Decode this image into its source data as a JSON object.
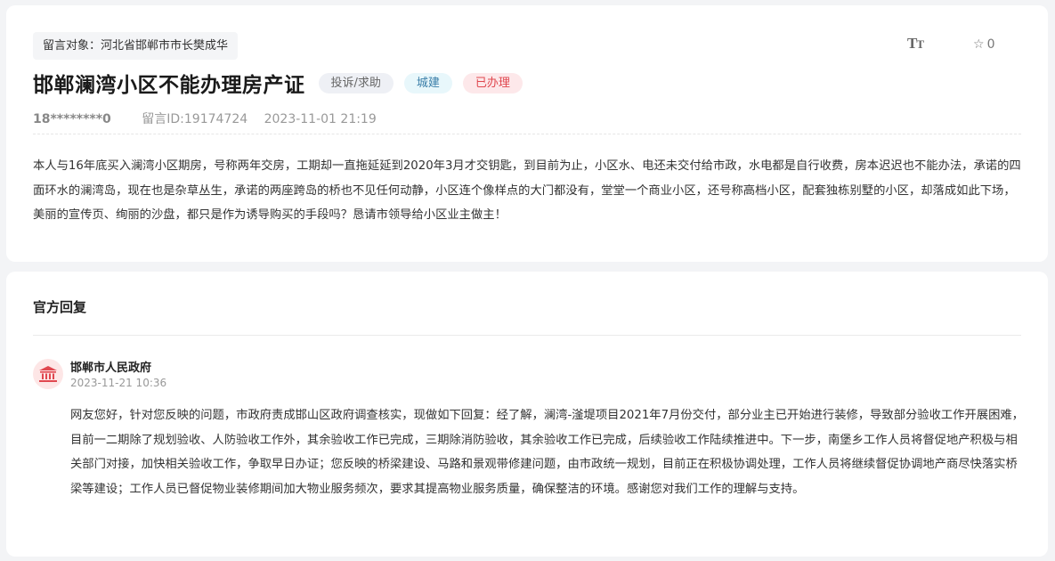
{
  "message": {
    "target_label": "留言对象：河北省邯郸市市长樊成华",
    "font_toggle_label": "TT",
    "favorites_count": "0",
    "title": "邯郸澜湾小区不能办理房产证",
    "tags": [
      "投诉/求助",
      "城建",
      "已办理"
    ],
    "user": "18********0",
    "message_id": "留言ID:19174724",
    "datetime": "2023-11-01 21:19",
    "body": "本人与16年底买入澜湾小区期房，号称两年交房，工期却一直拖延延到2020年3月才交钥匙，到目前为止，小区水、电还未交付给市政，水电都是自行收费，房本迟迟也不能办法，承诺的四面环水的澜湾岛，现在也是杂草丛生，承诺的两座跨岛的桥也不见任何动静，小区连个像样点的大门都没有，堂堂一个商业小区，还号称高档小区，配套独栋别墅的小区，却落成如此下场，美丽的宣传页、绚丽的沙盘，都只是作为诱导购买的手段吗？恳请市领导给小区业主做主！"
  },
  "reply": {
    "section_title": "官方回复",
    "org_name": "邯郸市人民政府",
    "datetime": "2023-11-21 10:36",
    "body": "网友您好，针对您反映的问题，市政府责成邯山区政府调查核实，现做如下回复：经了解，澜湾-滏堤项目2021年7月份交付，部分业主已开始进行装修，导致部分验收工作开展困难，目前一二期除了规划验收、人防验收工作外，其余验收工作已完成，三期除消防验收，其余验收工作已完成，后续验收工作陆续推进中。下一步，南堡乡工作人员将督促地产积极与相关部门对接，加快相关验收工作，争取早日办证；您反映的桥梁建设、马路和景观带修建问题，由市政统一规划，目前正在积极协调处理，工作人员将继续督促协调地产商尽快落实桥梁等建设；工作人员已督促物业装修期间加大物业服务频次，要求其提高物业服务质量，确保整洁的环境。感谢您对我们工作的理解与支持。"
  },
  "icons": {
    "font_size": "font-size-icon",
    "star": "star-icon",
    "org": "government-building-icon"
  },
  "colors": {
    "tag_status_text": "#e0474f",
    "tag_category_text": "#3a7ea8",
    "avatar_bg": "#fde6e6"
  }
}
